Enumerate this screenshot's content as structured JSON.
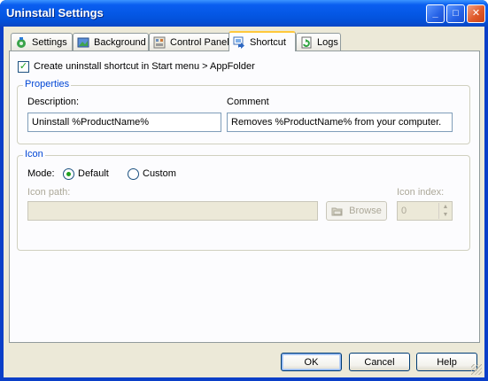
{
  "window": {
    "title": "Uninstall Settings",
    "controls": {
      "minimize": "_",
      "maximize": "□",
      "close": "✕"
    }
  },
  "tabs": [
    {
      "label": "Settings",
      "icon": "settings-icon"
    },
    {
      "label": "Background",
      "icon": "background-icon"
    },
    {
      "label": "Control Panel",
      "icon": "control-panel-icon"
    },
    {
      "label": "Shortcut",
      "icon": "shortcut-icon",
      "active": true
    },
    {
      "label": "Logs",
      "icon": "logs-icon"
    }
  ],
  "shortcut": {
    "create_checkbox_label": "Create uninstall shortcut in Start menu > AppFolder",
    "create_checked": true,
    "properties": {
      "legend": "Properties",
      "description_label": "Description:",
      "description_value": "Uninstall %ProductName%",
      "comment_label": "Comment",
      "comment_value": "Removes %ProductName% from your computer."
    },
    "icon": {
      "legend": "Icon",
      "mode_label": "Mode:",
      "mode_default": "Default",
      "mode_custom": "Custom",
      "selected_mode": "Default",
      "path_label": "Icon path:",
      "path_value": "",
      "browse_label": "Browse",
      "index_label": "Icon index:",
      "index_value": "0"
    }
  },
  "buttons": {
    "ok": "OK",
    "cancel": "Cancel",
    "help": "Help"
  },
  "colors": {
    "titlebar": "#0558e6",
    "client": "#ece9d8",
    "accent": "#0046d5",
    "check": "#21a121"
  }
}
